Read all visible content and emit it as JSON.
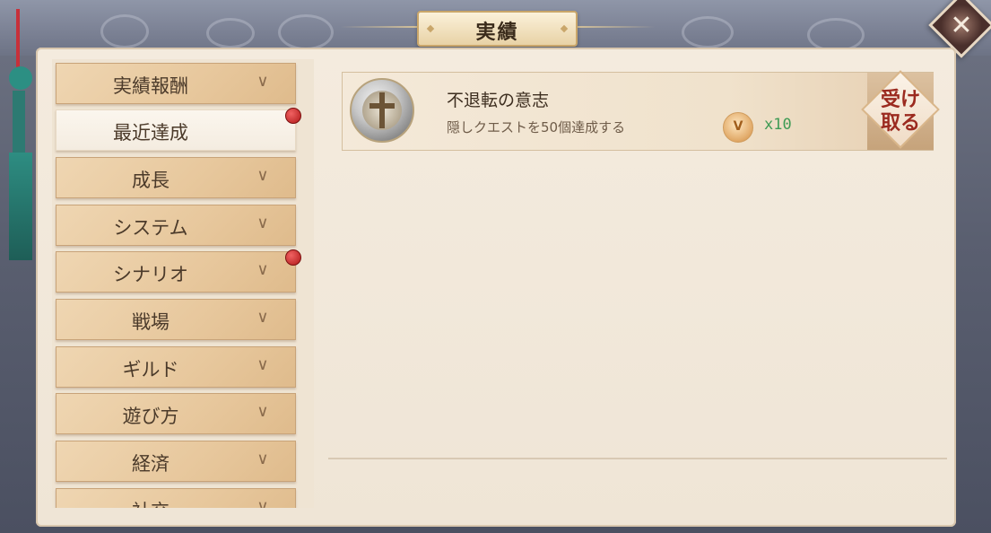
{
  "window": {
    "title": "実績"
  },
  "close": {
    "label": "✕"
  },
  "sidebar": {
    "items": [
      {
        "label": "実績報酬",
        "chevron": "∨",
        "selected": false,
        "badge": false
      },
      {
        "label": "最近達成",
        "chevron": "",
        "selected": true,
        "badge": true
      },
      {
        "label": "成長",
        "chevron": "∨",
        "selected": false,
        "badge": false
      },
      {
        "label": "システム",
        "chevron": "∨",
        "selected": false,
        "badge": false
      },
      {
        "label": "シナリオ",
        "chevron": "∨",
        "selected": false,
        "badge": true
      },
      {
        "label": "戦場",
        "chevron": "∨",
        "selected": false,
        "badge": false
      },
      {
        "label": "ギルド",
        "chevron": "∨",
        "selected": false,
        "badge": false
      },
      {
        "label": "遊び方",
        "chevron": "∨",
        "selected": false,
        "badge": false
      },
      {
        "label": "経済",
        "chevron": "∨",
        "selected": false,
        "badge": false
      },
      {
        "label": "社交",
        "chevron": "∨",
        "selected": false,
        "badge": false
      }
    ]
  },
  "achievement": {
    "icon": "sword-medal-icon",
    "title": "不退転の意志",
    "description": "隠しクエストを50個達成する",
    "reward_icon_letter": "V",
    "reward_count": "x10",
    "claim_label": "受け\n取る"
  }
}
